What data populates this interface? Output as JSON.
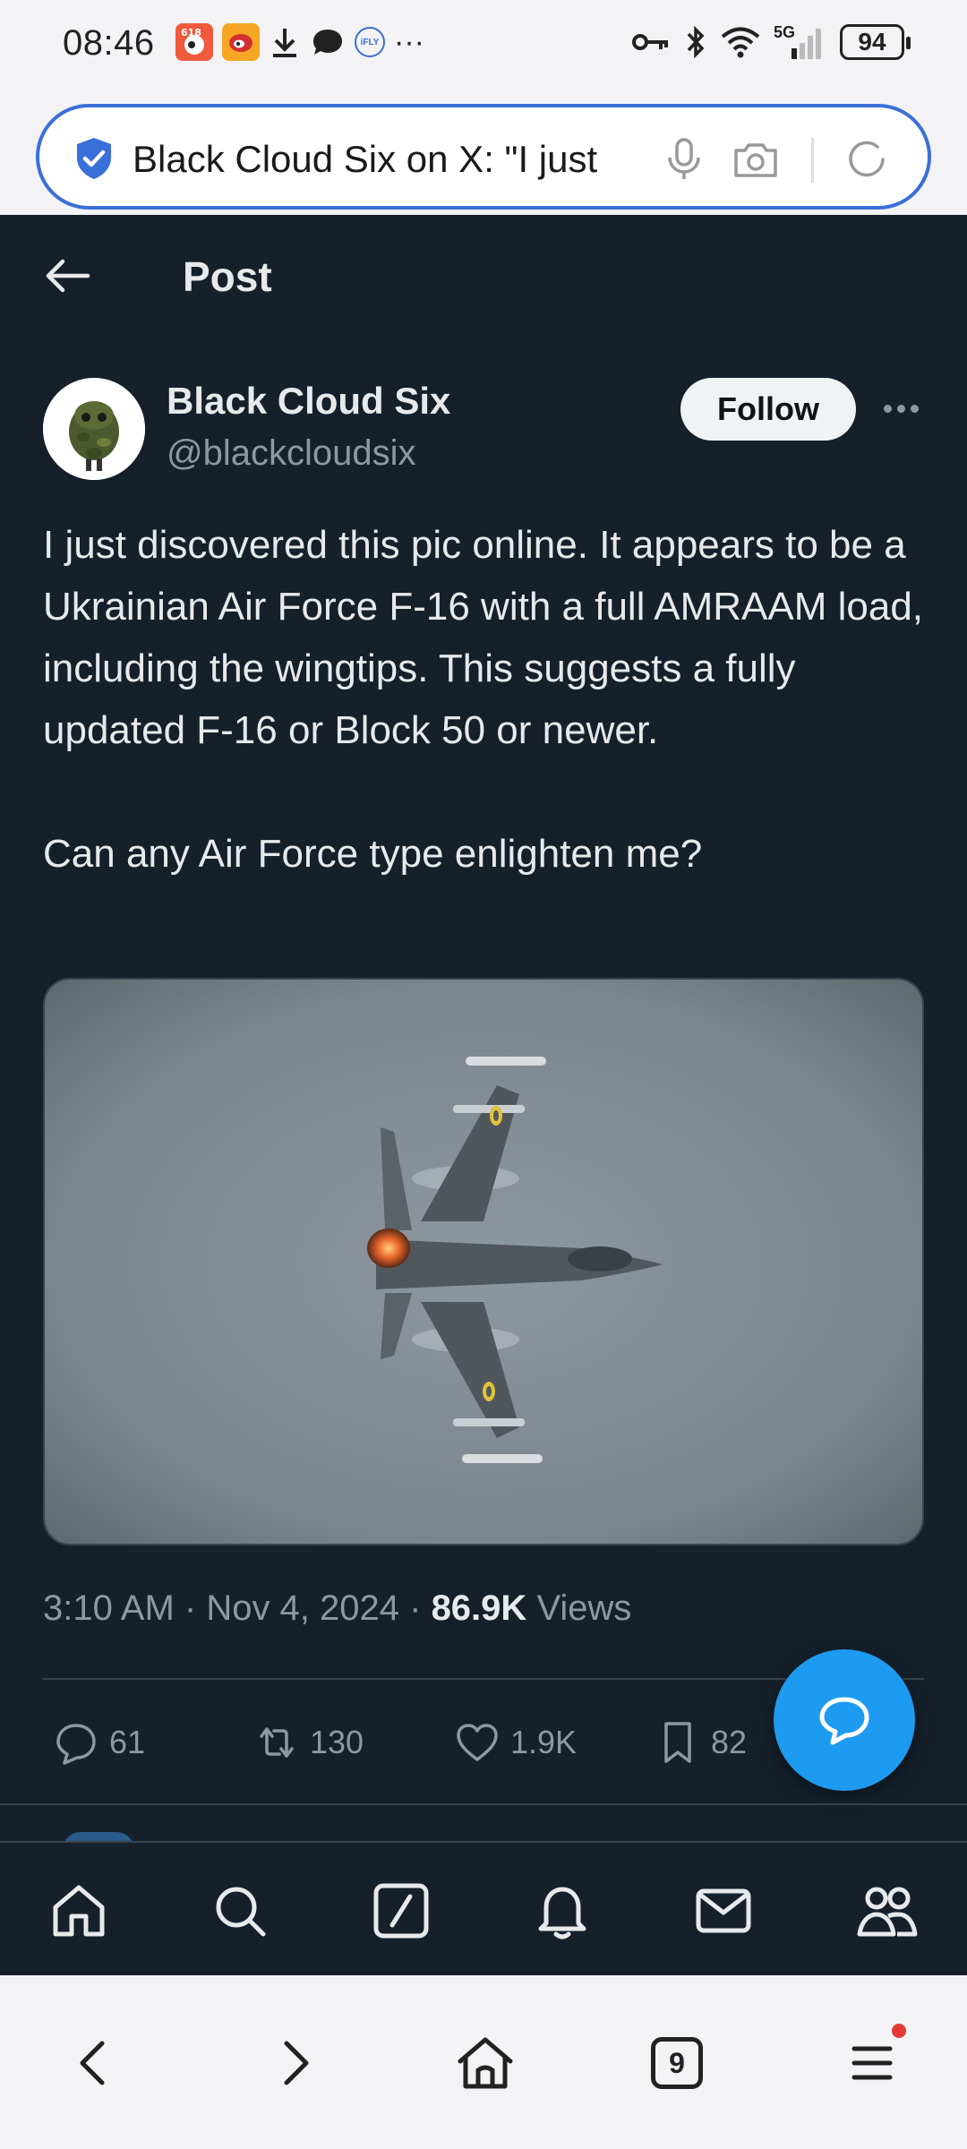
{
  "status_bar": {
    "time": "08:46",
    "battery": "94",
    "network": "5G",
    "icons": [
      "weibo-app-icon",
      "weibo-alt-icon",
      "download-icon",
      "chat-icon",
      "ifly-icon",
      "more-icon",
      "key-icon",
      "bluetooth-icon",
      "wifi-icon",
      "signal-icon",
      "battery-icon"
    ]
  },
  "browser": {
    "url_text": "Black Cloud Six on X: \"I just",
    "tab_count": "9"
  },
  "header": {
    "title": "Post"
  },
  "author": {
    "name": "Black Cloud Six",
    "handle": "@blackcloudsix",
    "follow_label": "Follow"
  },
  "post": {
    "paragraphs": [
      "I just discovered this pic online.  It appears to be a Ukrainian Air Force F-16 with a full AMRAAM load, including the wingtips.  This suggests a fully updated F-16 or Block 50 or newer.",
      "Can any Air Force type enlighten me?"
    ],
    "time": "3:10 AM",
    "date": "Nov 4, 2024",
    "views_count": "86.9K",
    "views_label": "Views"
  },
  "actions": {
    "replies": "61",
    "reposts": "130",
    "likes": "1.9K",
    "bookmarks": "82"
  },
  "colors": {
    "background": "#15202b",
    "accent": "#1d9bf0",
    "text": "#e7e9ea",
    "muted": "#8b98a5"
  }
}
